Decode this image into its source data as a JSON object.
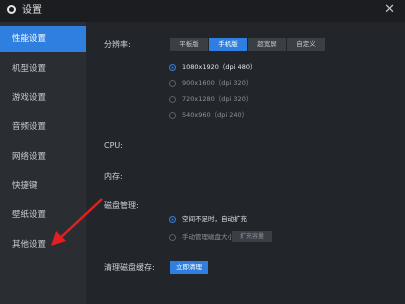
{
  "window": {
    "title": "设置",
    "close_glyph": "✕"
  },
  "sidebar": {
    "items": [
      {
        "label": "性能设置",
        "active": true
      },
      {
        "label": "机型设置",
        "active": false
      },
      {
        "label": "游戏设置",
        "active": false
      },
      {
        "label": "音频设置",
        "active": false
      },
      {
        "label": "网络设置",
        "active": false
      },
      {
        "label": "快捷键",
        "active": false
      },
      {
        "label": "壁纸设置",
        "active": false
      },
      {
        "label": "其他设置",
        "active": false
      }
    ]
  },
  "resolution": {
    "label": "分辨率:",
    "modes": [
      "平板版",
      "手机版",
      "超宽屏",
      "自定义"
    ],
    "selected_mode": "手机版",
    "options": [
      "1080x1920（dpi 480）",
      "900x1600（dpi 320）",
      "720x1280（dpi 320）",
      "540x960（dpi 240）"
    ],
    "selected_option": "1080x1920（dpi 480）"
  },
  "cpu": {
    "label": "CPU:"
  },
  "memory": {
    "label": "内存:"
  },
  "disk": {
    "label": "磁盘管理:",
    "options": [
      "空间不足时，自动扩充",
      "手动管理磁盘大小"
    ],
    "selected_option": "空间不足时，自动扩充",
    "expand_button": "扩充容量"
  },
  "cache": {
    "label": "清理磁盘缓存:",
    "button": "立即清理"
  },
  "colors": {
    "accent": "#2f7fe0",
    "annotation_arrow": "#e02020"
  }
}
